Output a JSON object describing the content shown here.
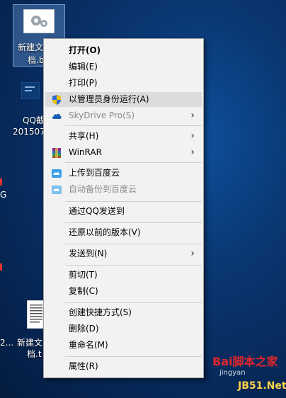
{
  "desktop": {
    "icons": [
      {
        "label1": "新建文",
        "label2": "档.b"
      },
      {
        "label1": "QQ截",
        "label2": "201507"
      },
      {
        "label1": "新建文",
        "label2": "档.t"
      },
      {
        "label1": "2..."
      }
    ],
    "edge_text": "G"
  },
  "menu": {
    "items": [
      {
        "label": "打开(O)"
      },
      {
        "label": "编辑(E)"
      },
      {
        "label": "打印(P)"
      },
      {
        "label": "以管理员身份运行(A)"
      },
      {
        "label": "SkyDrive Pro(S)"
      },
      {
        "label": "共享(H)"
      },
      {
        "label": "WinRAR"
      },
      {
        "label": "上传到百度云"
      },
      {
        "label": "自动备份到百度云"
      },
      {
        "label": "通过QQ发送到"
      },
      {
        "label": "还原以前的版本(V)"
      },
      {
        "label": "发送到(N)"
      },
      {
        "label": "剪切(T)"
      },
      {
        "label": "复制(C)"
      },
      {
        "label": "创建快捷方式(S)"
      },
      {
        "label": "删除(D)"
      },
      {
        "label": "重命名(M)"
      },
      {
        "label": "属性(R)"
      }
    ]
  },
  "watermark": {
    "line1": "Bai脚本之家",
    "line2": "jingyan",
    "line3": "JB51.Net"
  },
  "colors": {
    "menu_bg": "#f2f2f2",
    "hover_bg": "#dcdcdc",
    "disabled_text": "#8a8a8a",
    "desktop_bg": "#0a3773",
    "watermark_red": "#e0262b"
  }
}
